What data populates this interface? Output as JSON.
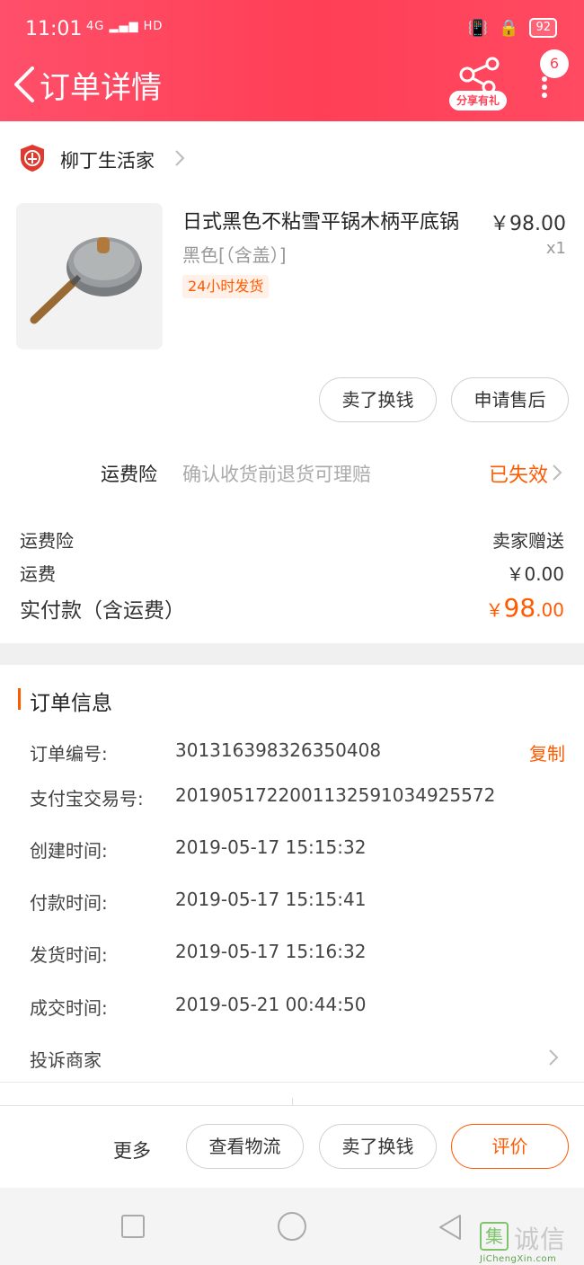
{
  "status_bar": {
    "time": "11:01",
    "network": "4G",
    "network_extra": "HD",
    "battery": "92"
  },
  "header": {
    "title": "订单详情",
    "share_label": "分享有礼",
    "badge_count": "6"
  },
  "shop": {
    "name": "柳丁生活家"
  },
  "product": {
    "title": "日式黑色不粘雪平锅木柄平底锅",
    "sku": "黑色[（含盖）]",
    "tag": "24小时发货",
    "price": "￥98.00",
    "quantity": "x1"
  },
  "item_actions": {
    "sell_label": "卖了换钱",
    "aftersale_label": "申请售后"
  },
  "insurance": {
    "label": "运费险",
    "description": "确认收货前退货可理赔",
    "status": "已失效"
  },
  "fees": [
    {
      "label": "运费险",
      "value": "卖家赠送"
    },
    {
      "label": "运费",
      "value": "￥0.00"
    }
  ],
  "total": {
    "label": "实付款（含运费）",
    "currency": "￥",
    "integer": "98",
    "decimal": ".00"
  },
  "order_info": {
    "section_title": "订单信息",
    "copy_label": "复制",
    "rows": [
      {
        "label": "订单编号:",
        "value": "301316398326350408"
      },
      {
        "label": "支付宝交易号:",
        "value": "2019051722001132591034925572"
      },
      {
        "label": "创建时间:",
        "value": "2019-05-17 15:15:32"
      },
      {
        "label": "付款时间:",
        "value": "2019-05-17 15:15:41"
      },
      {
        "label": "发货时间:",
        "value": "2019-05-17 15:16:32"
      },
      {
        "label": "成交时间:",
        "value": "2019-05-21 00:44:50"
      }
    ],
    "complaint_label": "投诉商家"
  },
  "bottom_bar": {
    "more_label": "更多",
    "logistics_label": "查看物流",
    "sell_label": "卖了换钱",
    "review_label": "评价"
  },
  "watermark": {
    "logo_char": "集",
    "text": "诚信",
    "url": "JiChengXin.com"
  },
  "colors": {
    "header": "#ff4660",
    "accent": "#ff5a00",
    "tag_bg": "#fff1e8"
  }
}
